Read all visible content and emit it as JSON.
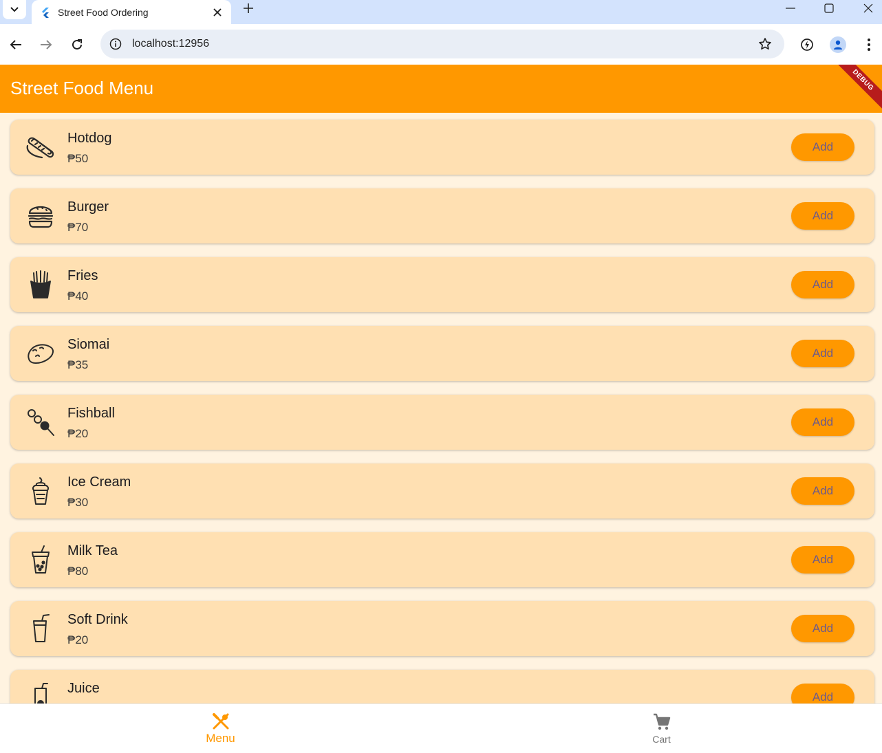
{
  "browser": {
    "tab_title": "Street Food Ordering",
    "url": "localhost:12956"
  },
  "app": {
    "title": "Street Food Menu",
    "debug_label": "DEBUG",
    "accent_color": "#ff9800"
  },
  "menu_items": [
    {
      "name": "Hotdog",
      "price": "₱50",
      "icon": "hotdog-icon",
      "button": "Add"
    },
    {
      "name": "Burger",
      "price": "₱70",
      "icon": "burger-icon",
      "button": "Add"
    },
    {
      "name": "Fries",
      "price": "₱40",
      "icon": "fries-icon",
      "button": "Add"
    },
    {
      "name": "Siomai",
      "price": "₱35",
      "icon": "siomai-icon",
      "button": "Add"
    },
    {
      "name": "Fishball",
      "price": "₱20",
      "icon": "fishball-icon",
      "button": "Add"
    },
    {
      "name": "Ice Cream",
      "price": "₱30",
      "icon": "ice-cream-icon",
      "button": "Add"
    },
    {
      "name": "Milk Tea",
      "price": "₱80",
      "icon": "milk-tea-icon",
      "button": "Add"
    },
    {
      "name": "Soft Drink",
      "price": "₱20",
      "icon": "soft-drink-icon",
      "button": "Add"
    },
    {
      "name": "Juice",
      "price": "",
      "icon": "juice-icon",
      "button": "Add"
    }
  ],
  "bottom_nav": {
    "menu_label": "Menu",
    "cart_label": "Cart",
    "active": "Menu"
  }
}
